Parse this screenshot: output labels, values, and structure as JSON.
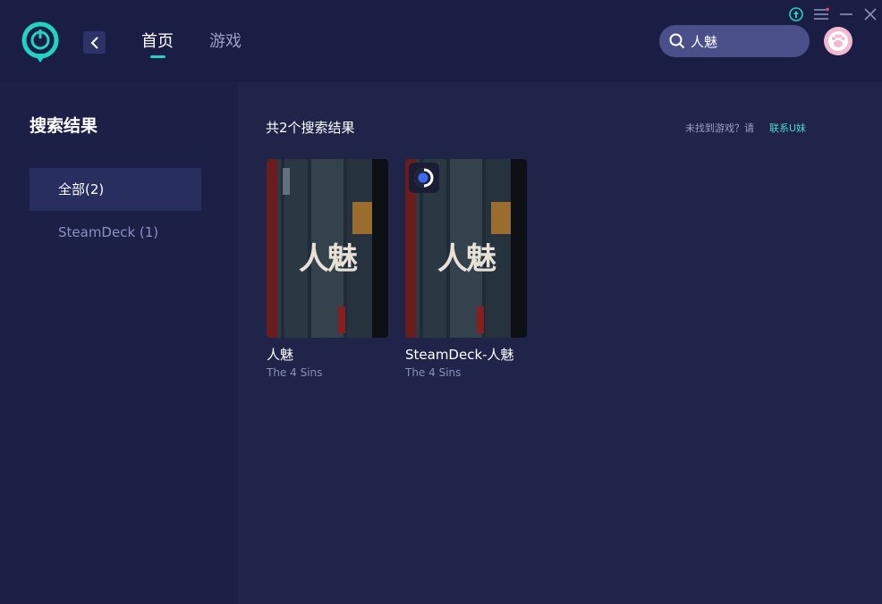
{
  "header": {
    "nav_tabs": [
      {
        "label": "首页",
        "active": true
      },
      {
        "label": "游戏",
        "active": false
      }
    ],
    "search_value": "人魅",
    "accent_color": "#22d3c5"
  },
  "sidebar": {
    "title": "搜索结果",
    "items": [
      {
        "label": "全部(2)",
        "active": true
      },
      {
        "label": "SteamDeck (1)",
        "active": false
      }
    ]
  },
  "main": {
    "result_count": "共2个搜索结果",
    "not_found_text": "未找到游戏？请",
    "contact_link": "联系U妹",
    "cards": [
      {
        "title": "人魅",
        "subtitle": "The 4 Sins",
        "cover_text": "人魅",
        "badge": null
      },
      {
        "title": "SteamDeck-人魅",
        "subtitle": "The 4 Sins",
        "cover_text": "人魅",
        "badge": "steamdeck-icon"
      }
    ]
  }
}
